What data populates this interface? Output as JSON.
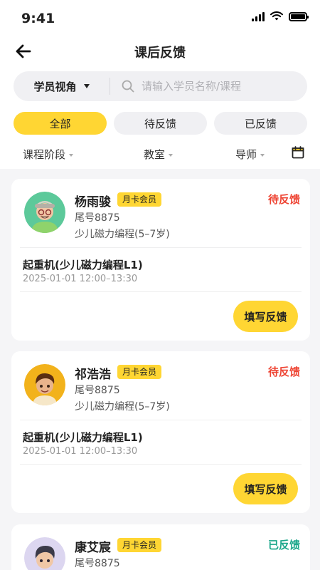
{
  "status_bar": {
    "time": "9:41"
  },
  "header": {
    "title": "课后反馈"
  },
  "search": {
    "view_label": "学员视角",
    "placeholder": "请输入学员名称/课程"
  },
  "filter_tabs": [
    {
      "label": "全部",
      "active": true
    },
    {
      "label": "待反馈",
      "active": false
    },
    {
      "label": "已反馈",
      "active": false
    }
  ],
  "sort_filters": [
    {
      "label": "课程阶段"
    },
    {
      "label": "教室"
    },
    {
      "label": "导师"
    }
  ],
  "cards": [
    {
      "name": "杨雨骏",
      "badge": "月卡会员",
      "status": "待反馈",
      "tail": "尾号8875",
      "course": "少儿磁力编程(5–7岁)",
      "lesson": "起重机(少儿磁力编程L1)",
      "time": "2025-01-01 12:00–13:30",
      "button": "填写反馈"
    },
    {
      "name": "祁浩浩",
      "badge": "月卡会员",
      "status": "待反馈",
      "tail": "尾号8875",
      "course": "少儿磁力编程(5–7岁)",
      "lesson": "起重机(少儿磁力编程L1)",
      "time": "2025-01-01 12:00–13:30",
      "button": "填写反馈"
    },
    {
      "name": "康艾宸",
      "badge": "月卡会员",
      "status": "已反馈",
      "tail": "尾号8875"
    }
  ],
  "colors": {
    "accent": "#ffd633",
    "pending": "#ee4433",
    "done": "#1aa68a"
  },
  "icons": [
    "back-arrow-icon",
    "search-icon",
    "calendar-icon",
    "signal-icon",
    "wifi-icon",
    "battery-icon"
  ]
}
